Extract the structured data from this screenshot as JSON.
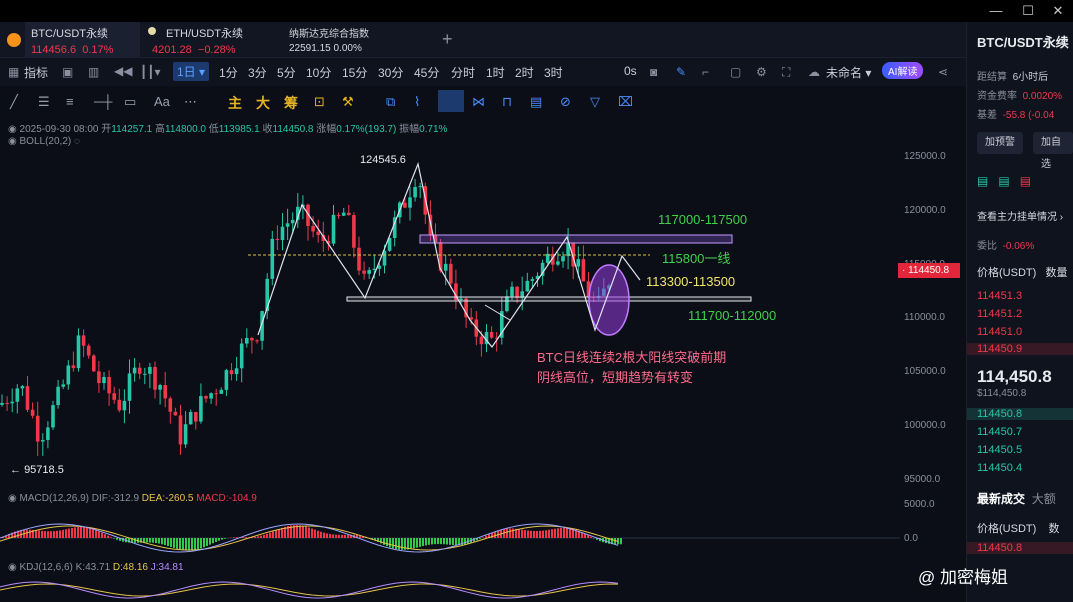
{
  "tabs": [
    {
      "title": "BTC/USDT永续",
      "price": "114456.6",
      "change": "0.17%"
    },
    {
      "title": "ETH/USDT永续",
      "price": "4201.28",
      "change": "−0.28%"
    },
    {
      "title": "纳斯达克综合指数",
      "price": "22591.15",
      "change": "0.00%"
    }
  ],
  "add_tab": "+",
  "toolbar": {
    "indicators": "指标",
    "interval_selected": "1日",
    "intervals": [
      "1分",
      "3分",
      "5分",
      "10分",
      "15分",
      "30分",
      "45分",
      "分时",
      "1时",
      "2时",
      "3时"
    ],
    "zero_s": "0s",
    "layout_name": "未命名",
    "ai_button": "AI解读"
  },
  "drawing": {
    "main": "主",
    "big": "大",
    "chip": "筹"
  },
  "ohlc": {
    "date": "2025-09-30 08:00",
    "open_label": "开",
    "open": "114257.1",
    "high_label": "高",
    "high": "114800.0",
    "low_label": "低",
    "low": "113985.1",
    "close_label": "收",
    "close": "114450.8",
    "chg_label": "涨幅",
    "chg": "0.17%(193.7)",
    "amp_label": "振幅",
    "amp": "0.71%"
  },
  "boll_label": "BOLL(20,2)",
  "price_axis": [
    "125000.0",
    "120000.0",
    "115000.0",
    "110000.0",
    "105000.0",
    "100000.0",
    "95000.0"
  ],
  "current_price": "114450.8",
  "annotations": {
    "high": "124545.6",
    "low": "95718.5",
    "r1": "117000-117500",
    "mid": "115800一线",
    "s1": "113300-113500",
    "s2": "111700-112000",
    "note_line1": "BTC日线连续2根大阳线突破前期",
    "note_line2": "阴线高位，短期趋势有转变"
  },
  "macd": {
    "label": "MACD(12,26,9)",
    "dif": "DIF:-312.9",
    "dea": "DEA:-260.5",
    "macd": "MACD:-104.9",
    "axis_top": "5000.0",
    "axis_zero": "0.0"
  },
  "kdj": {
    "label": "KDJ(12,6,6)",
    "k": "K:43.71",
    "d": "D:48.16",
    "j": "J:34.81"
  },
  "sidebar": {
    "title": "BTC/USDT永续",
    "settle_label": "距结算",
    "settle_value": "6小时后",
    "funding_label": "资金费率",
    "funding_value": "0.0020%",
    "basis_label": "基差",
    "basis_value": "-55.8 (-0.04",
    "btn_alert": "加预警",
    "btn_add": "加自选",
    "check_text": "查看主力挂单情况",
    "ratio_label": "委比",
    "ratio_value": "-0.06%",
    "col_price": "价格(USDT)",
    "col_qty": "数量",
    "asks": [
      "114451.3",
      "114451.2",
      "114451.0",
      "114450.9"
    ],
    "last_price": "114,450.8",
    "last_sub": "$114,450.8",
    "bids": [
      "114450.8",
      "114450.7",
      "114450.5",
      "114450.4"
    ],
    "trades_tab": "最新成交",
    "trades_tab2": "大额",
    "trade_col": "价格(USDT)",
    "trade_col2": "数",
    "trade_first": "114450.8"
  },
  "watermark": "@ 加密梅姐",
  "colors": {
    "up": "#26c6a6",
    "down": "#f0384a",
    "accent": "#4a8cff",
    "resistance": "#a06cff"
  }
}
